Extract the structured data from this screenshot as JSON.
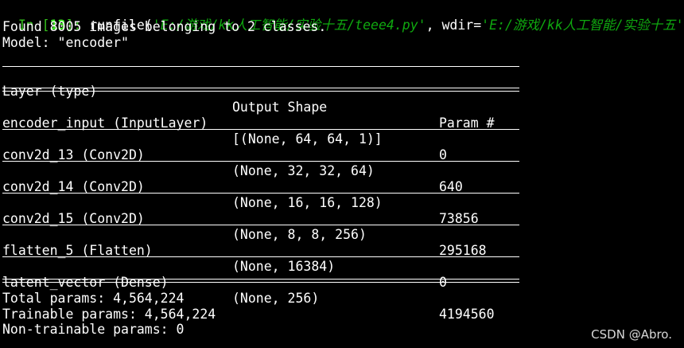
{
  "console": {
    "prompt_in": "In [",
    "prompt_num": "13",
    "prompt_close": "]:",
    "call_prefix": " runfile(",
    "arg_file": "'E:/游戏/kk人工智能/实验十五/teee4.py'",
    "arg_sep": ", wdir=",
    "arg_wdir": "'E:/游戏/kk人工智能/实验十五'",
    "found_line": "Found 8005 images belonging to 2 classes.",
    "model_line": "Model: \"encoder\""
  },
  "summary": {
    "headers": {
      "layer": "Layer (type)",
      "output": "Output Shape",
      "param": "Param #"
    },
    "rows": [
      {
        "layer": "encoder_input (InputLayer)",
        "output": "[(None, 64, 64, 1)]",
        "param": "0"
      },
      {
        "layer": "conv2d_13 (Conv2D)",
        "output": "(None, 32, 32, 64)",
        "param": "640"
      },
      {
        "layer": "conv2d_14 (Conv2D)",
        "output": "(None, 16, 16, 128)",
        "param": "73856"
      },
      {
        "layer": "conv2d_15 (Conv2D)",
        "output": "(None, 8, 8, 256)",
        "param": "295168"
      },
      {
        "layer": "flatten_5 (Flatten)",
        "output": "(None, 16384)",
        "param": "0"
      },
      {
        "layer": "latent_vector (Dense)",
        "output": "(None, 256)",
        "param": "4194560"
      }
    ],
    "total": "Total params: 4,564,224",
    "trainable": "Trainable params: 4,564,224",
    "non_trainable": "Non-trainable params: 0"
  },
  "watermark": "CSDN @Abro."
}
